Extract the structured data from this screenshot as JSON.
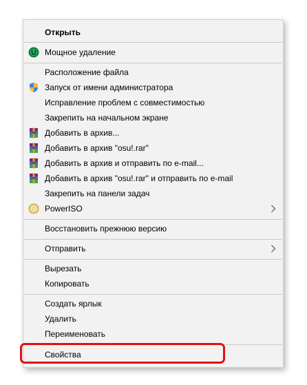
{
  "menu": {
    "items": [
      {
        "label": "Открыть",
        "bold": true
      },
      {
        "label": "Мощное удаление",
        "icon": "uninstaller-icon"
      },
      {
        "label": "Расположение файла"
      },
      {
        "label": "Запуск от имени администратора",
        "icon": "uac-shield-icon"
      },
      {
        "label": "Исправление проблем с совместимостью"
      },
      {
        "label": "Закрепить на начальном экране"
      },
      {
        "label": "Добавить в архив...",
        "icon": "winrar-icon"
      },
      {
        "label": "Добавить в архив \"osu!.rar\"",
        "icon": "winrar-icon"
      },
      {
        "label": "Добавить в архив и отправить по e-mail...",
        "icon": "winrar-icon"
      },
      {
        "label": "Добавить в архив \"osu!.rar\" и отправить по e-mail",
        "icon": "winrar-icon"
      },
      {
        "label": "Закрепить на панели задач"
      },
      {
        "label": "PowerISO",
        "icon": "poweriso-icon",
        "submenu": true
      },
      {
        "label": "Восстановить прежнюю версию"
      },
      {
        "label": "Отправить",
        "submenu": true
      },
      {
        "label": "Вырезать"
      },
      {
        "label": "Копировать"
      },
      {
        "label": "Создать ярлык"
      },
      {
        "label": "Удалить"
      },
      {
        "label": "Переименовать"
      },
      {
        "label": "Свойства"
      }
    ]
  },
  "colors": {
    "menu_background": "#f2f2f2",
    "separator": "#c8c8c8",
    "highlight_border": "#e01010"
  }
}
